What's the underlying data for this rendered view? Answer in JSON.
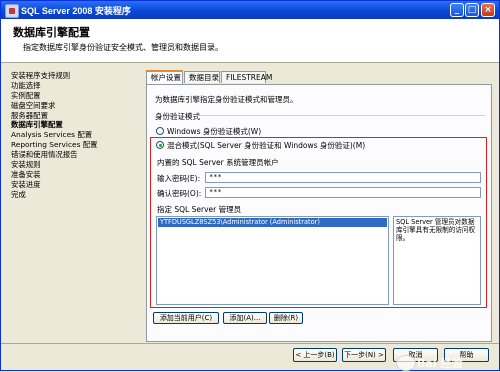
{
  "window": {
    "title": "SQL Server 2008 安装程序"
  },
  "header": {
    "title": "数据库引擎配置",
    "subtitle": "指定数据库引擎身份验证安全模式、管理员和数据目录。"
  },
  "nav": {
    "items": [
      "安装程序支持规则",
      "功能选择",
      "实例配置",
      "磁盘空间要求",
      "服务器配置",
      "数据库引擎配置",
      "Analysis Services 配置",
      "Reporting Services 配置",
      "错误和使用情况报告",
      "安装规则",
      "准备安装",
      "安装进度",
      "完成"
    ],
    "active_index": 5
  },
  "tabs": [
    "帐户设置",
    "数据目录",
    "FILESTREAM"
  ],
  "auth": {
    "description": "为数据库引擎指定身份验证模式和管理员。",
    "section_label": "身份验证模式",
    "windows_mode": "Windows 身份验证模式(W)",
    "mixed_mode": "混合模式(SQL Server 身份验证和 Windows 身份验证)(M)",
    "selected": "mixed"
  },
  "sa": {
    "section_label": "内置的 SQL Server 系统管理员帐户",
    "password_label": "输入密码(E):",
    "password_value": "***",
    "confirm_label": "确认密码(O):",
    "confirm_value": "***"
  },
  "admins": {
    "section_label": "指定 SQL Server 管理员",
    "entries": [
      "YTFDUSGLZ8SZ53\\Administrator (Administrator)"
    ],
    "info": "SQL Server 管理员对数据库引擎具有无限制的访问权限。",
    "add_current_label": "添加当前用户(C)",
    "add_label": "添加(A)...",
    "remove_label": "删除(R)"
  },
  "footer": {
    "prev_label": "< 上一步(B)",
    "next_label": "下一步(N) >",
    "cancel_label": "取消",
    "help_label": "帮助"
  },
  "watermark": {
    "text": "Bai 经验"
  },
  "colors": {
    "highlight_box": "#e02020",
    "selection": "#316ac5",
    "title_bar": "#0a49d6"
  }
}
